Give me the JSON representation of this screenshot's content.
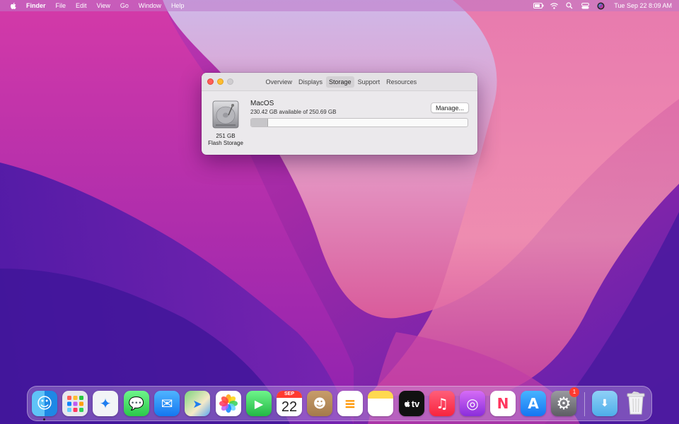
{
  "menubar": {
    "app_name": "Finder",
    "menus": [
      "File",
      "Edit",
      "View",
      "Go",
      "Window",
      "Help"
    ],
    "clock": "Tue Sep 22  8:09 AM",
    "status_icons": [
      "battery-icon",
      "wifi-icon",
      "search-icon",
      "control-center-icon",
      "siri-icon"
    ]
  },
  "window": {
    "tabs": [
      "Overview",
      "Displays",
      "Storage",
      "Support",
      "Resources"
    ],
    "active_tab": "Storage",
    "disk": {
      "size_label": "251 GB",
      "type_label": "Flash Storage",
      "volume_name": "MacOS",
      "available_text": "230.42 GB available of 250.69 GB",
      "used_fraction": 0.08,
      "manage_label": "Manage..."
    }
  },
  "dock": {
    "apps": [
      {
        "name": "Finder",
        "icon": "finder-icon",
        "running": true
      },
      {
        "name": "Launchpad",
        "icon": "launchpad-icon"
      },
      {
        "name": "Safari",
        "icon": "safari-icon"
      },
      {
        "name": "Messages",
        "icon": "messages-icon"
      },
      {
        "name": "Mail",
        "icon": "mail-icon"
      },
      {
        "name": "Maps",
        "icon": "maps-icon"
      },
      {
        "name": "Photos",
        "icon": "photos-icon"
      },
      {
        "name": "FaceTime",
        "icon": "facetime-icon"
      },
      {
        "name": "Calendar",
        "icon": "calendar-icon",
        "month": "SEP",
        "day": "22"
      },
      {
        "name": "Contacts",
        "icon": "contacts-icon"
      },
      {
        "name": "Reminders",
        "icon": "reminders-icon"
      },
      {
        "name": "Notes",
        "icon": "notes-icon"
      },
      {
        "name": "TV",
        "icon": "tv-icon",
        "label": "tv"
      },
      {
        "name": "Music",
        "icon": "music-icon"
      },
      {
        "name": "Podcasts",
        "icon": "podcasts-icon"
      },
      {
        "name": "News",
        "icon": "news-icon"
      },
      {
        "name": "App Store",
        "icon": "app-store-icon"
      },
      {
        "name": "System Preferences",
        "icon": "system-preferences-icon",
        "badge": "1"
      },
      {
        "name": "Downloads",
        "icon": "downloads-folder-icon"
      },
      {
        "name": "Trash",
        "icon": "trash-icon"
      }
    ]
  },
  "colors": {
    "accent_red": "#ff5f57",
    "accent_yellow": "#febc2e",
    "badge_red": "#ff3b30"
  }
}
